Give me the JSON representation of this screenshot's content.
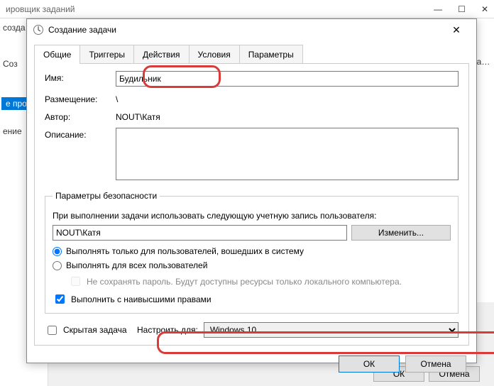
{
  "bg": {
    "title_fragment": "ировщик заданий",
    "sidebar": {
      "create": "созда",
      "co3": "Соз",
      "active": "е про",
      "ware": "ение"
    },
    "right": {
      "pa": "ра…"
    },
    "btn_ok": "ОК",
    "btn_cancel": "Отмена"
  },
  "dialog": {
    "title": "Создание задачи",
    "tabs": [
      "Общие",
      "Триггеры",
      "Действия",
      "Условия",
      "Параметры"
    ],
    "labels": {
      "name": "Имя:",
      "location": "Размещение:",
      "author": "Автор:",
      "description": "Описание:"
    },
    "values": {
      "name": "Будильник",
      "location": "\\",
      "author": "NOUT\\Катя",
      "description": ""
    },
    "security": {
      "legend": "Параметры безопасности",
      "run_as_label": "При выполнении задачи использовать следующую учетную запись пользователя:",
      "account": "NOUT\\Катя",
      "change_btn": "Изменить...",
      "radio_logged": "Выполнять только для пользователей, вошедших в систему",
      "radio_all": "Выполнять для всех пользователей",
      "nosave_pw": "Не сохранять пароль. Будут доступны ресурсы только локального компьютера.",
      "highest": "Выполнить с наивысшими правами"
    },
    "hidden_label": "Скрытая задача",
    "configure_label": "Настроить для:",
    "configure_value": "Windows 10",
    "ok": "ОК",
    "cancel": "Отмена"
  }
}
